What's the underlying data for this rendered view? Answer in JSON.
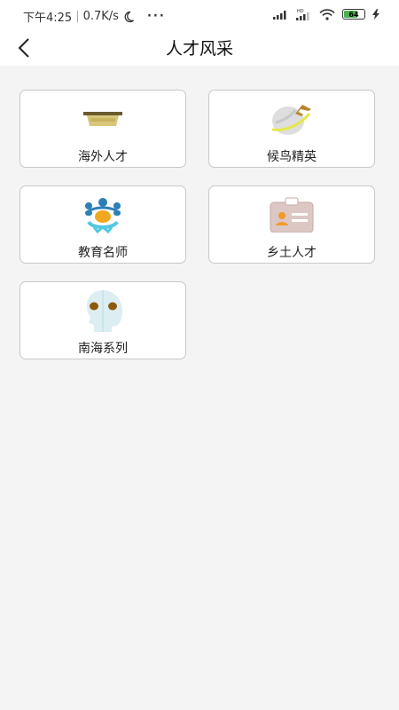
{
  "status_bar": {
    "time": "下午4:25",
    "speed": "0.7K/s",
    "battery": "64"
  },
  "header": {
    "title": "人才风采"
  },
  "categories": [
    {
      "label": "海外人才",
      "icon": "overseas-icon"
    },
    {
      "label": "候鸟精英",
      "icon": "migratory-plane-icon"
    },
    {
      "label": "教育名师",
      "icon": "teachers-group-icon"
    },
    {
      "label": "乡土人才",
      "icon": "id-card-icon"
    },
    {
      "label": "南海系列",
      "icon": "head-profile-icon"
    }
  ]
}
